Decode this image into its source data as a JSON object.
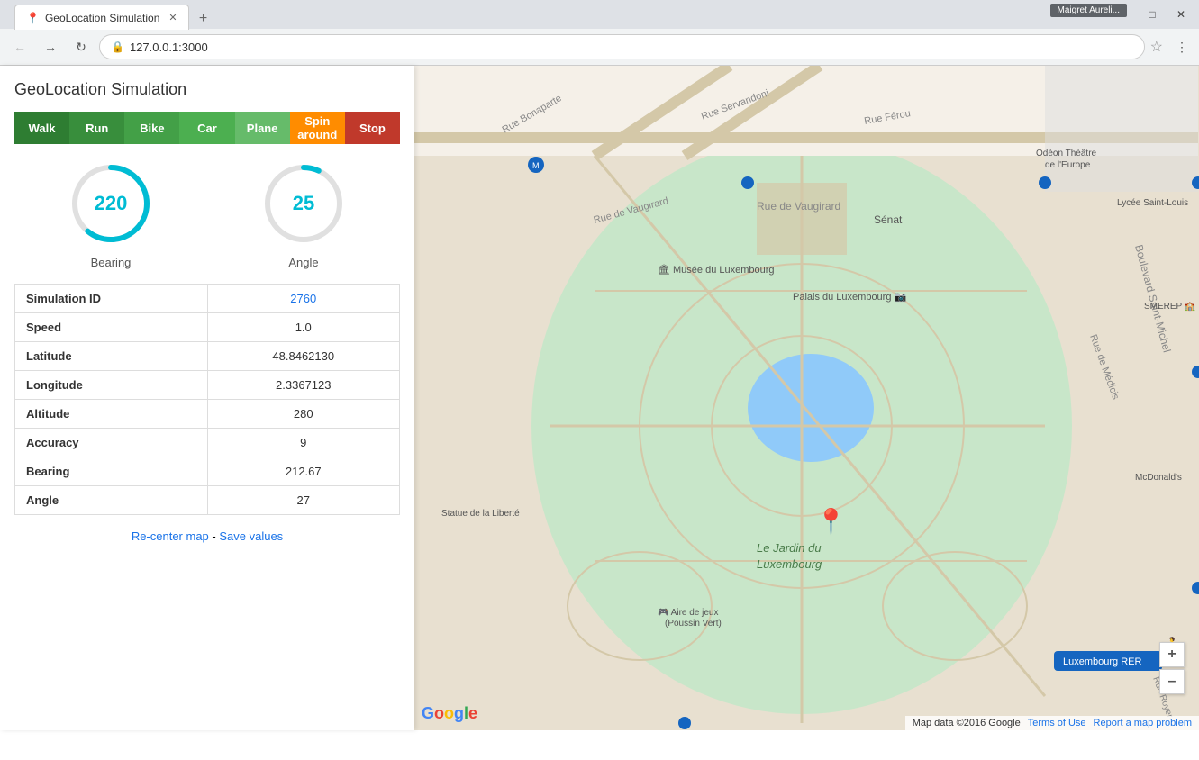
{
  "browser": {
    "title_bar_label": "Maigret Aureli...",
    "tab_title": "GeoLocation Simulation",
    "url": "127.0.0.1:3000",
    "window_controls": {
      "minimize": "–",
      "maximize": "□",
      "close": "✕"
    }
  },
  "panel": {
    "title": "GeoLocation Simulation",
    "mode_buttons": [
      {
        "id": "walk",
        "label": "Walk",
        "class": "walk"
      },
      {
        "id": "run",
        "label": "Run",
        "class": "run"
      },
      {
        "id": "bike",
        "label": "Bike",
        "class": "bike"
      },
      {
        "id": "car",
        "label": "Car",
        "class": "car"
      },
      {
        "id": "plane",
        "label": "Plane",
        "class": "plane"
      },
      {
        "id": "spin-around",
        "label": "Spin around",
        "class": "spin-around"
      },
      {
        "id": "stop",
        "label": "Stop",
        "class": "stop"
      }
    ],
    "gauges": {
      "bearing": {
        "label": "Bearing",
        "value": "220",
        "progress": 0.611
      },
      "angle": {
        "label": "Angle",
        "value": "25",
        "progress": 0.069
      }
    },
    "table": {
      "rows": [
        {
          "key": "Simulation ID",
          "value": "2760",
          "is_link": true
        },
        {
          "key": "Speed",
          "value": "1.0",
          "is_link": false
        },
        {
          "key": "Latitude",
          "value": "48.8462130",
          "is_link": false
        },
        {
          "key": "Longitude",
          "value": "2.3367123",
          "is_link": false
        },
        {
          "key": "Altitude",
          "value": "280",
          "is_link": false
        },
        {
          "key": "Accuracy",
          "value": "9",
          "is_link": false
        },
        {
          "key": "Bearing",
          "value": "212.67",
          "is_link": false
        },
        {
          "key": "Angle",
          "value": "27",
          "is_link": false
        }
      ]
    },
    "links": {
      "recenter": "Re-center map",
      "separator": " - ",
      "save": "Save values"
    }
  },
  "map": {
    "pin_label": "Le Jardin du Luxembourg",
    "footer": {
      "data_label": "Map data ©2016 Google",
      "terms": "Terms of Use",
      "report": "Report a map problem"
    },
    "controls": {
      "zoom_in": "+",
      "zoom_out": "–"
    }
  },
  "colors": {
    "gauge_track": "#e0e0e0",
    "gauge_fill": "#00bcd4",
    "link_blue": "#1a73e8"
  }
}
